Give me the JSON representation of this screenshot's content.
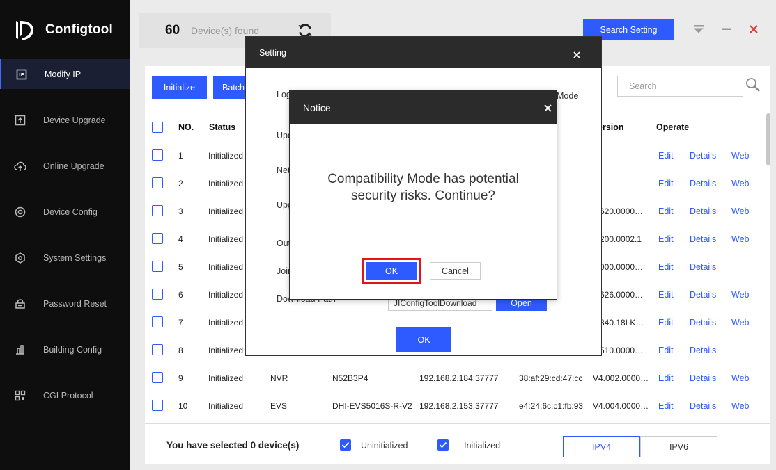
{
  "app": {
    "name": "Configtool"
  },
  "sidebar": {
    "items": [
      {
        "label": "Modify IP",
        "icon": "ip-icon",
        "active": true
      },
      {
        "label": "Device Upgrade",
        "icon": "upgrade-icon"
      },
      {
        "label": "Online Upgrade",
        "icon": "cloud-upgrade-icon"
      },
      {
        "label": "Device Config",
        "icon": "target-icon"
      },
      {
        "label": "System Settings",
        "icon": "hexagon-gear-icon"
      },
      {
        "label": "Password Reset",
        "icon": "lock-icon"
      },
      {
        "label": "Building Config",
        "icon": "building-icon"
      },
      {
        "label": "CGI Protocol",
        "icon": "qr-icon"
      }
    ]
  },
  "topbar": {
    "count": "60",
    "found_label": "Device(s) found",
    "search_setting_label": "Search Setting"
  },
  "toolbar": {
    "initialize_label": "Initialize",
    "batch_label": "Batch",
    "search_placeholder": "Search"
  },
  "table": {
    "headers": {
      "no": "NO.",
      "status": "Status",
      "version": "ersion",
      "operate": "Operate"
    },
    "rows": [
      {
        "no": "1",
        "status": "Initialized",
        "type": "",
        "model": "",
        "ip": "",
        "mac": "",
        "version": "",
        "edit": "Edit",
        "details": "Details",
        "web": "Web"
      },
      {
        "no": "2",
        "status": "Initialized",
        "type": "",
        "model": "",
        "ip": "",
        "mac": "",
        "version": "",
        "edit": "Edit",
        "details": "Details",
        "web": "Web"
      },
      {
        "no": "3",
        "status": "Initialized",
        "type": "",
        "model": "",
        "ip": "",
        "mac": "",
        "version": "2.620.0000…",
        "edit": "Edit",
        "details": "Details",
        "web": "Web"
      },
      {
        "no": "4",
        "status": "Initialized",
        "type": "",
        "model": "",
        "ip": "",
        "mac": "",
        "version": "3.200.0002.1",
        "edit": "Edit",
        "details": "Details",
        "web": "Web"
      },
      {
        "no": "5",
        "status": "Initialized",
        "type": "",
        "model": "",
        "ip": "",
        "mac": "",
        "version": "2.000.0000…",
        "edit": "Edit",
        "details": "Details",
        "web": ""
      },
      {
        "no": "6",
        "status": "Initialized",
        "type": "",
        "model": "",
        "ip": "",
        "mac": "",
        "version": "2.626.0000…",
        "edit": "Edit",
        "details": "Details",
        "web": "Web"
      },
      {
        "no": "7",
        "status": "Initialized",
        "type": "",
        "model": "",
        "ip": "",
        "mac": "",
        "version": "2.840.18LK…",
        "edit": "Edit",
        "details": "Details",
        "web": "Web"
      },
      {
        "no": "8",
        "status": "Initialized",
        "type": "",
        "model": "",
        "ip": "",
        "mac": "",
        "version": "2.510.0000…",
        "edit": "Edit",
        "details": "Details",
        "web": ""
      },
      {
        "no": "9",
        "status": "Initialized",
        "type": "NVR",
        "model": "N52B3P4",
        "ip": "192.168.2.184:37777",
        "mac": "38:af:29:cd:47:cc",
        "version": "V4.002.0000…",
        "edit": "Edit",
        "details": "Details",
        "web": "Web"
      },
      {
        "no": "10",
        "status": "Initialized",
        "type": "EVS",
        "model": "DHI-EVS5016S-R-V2",
        "ip": "192.168.2.153:37777",
        "mac": "e4:24:6c:c1:fb:93",
        "version": "V4.004.0000…",
        "edit": "Edit",
        "details": "Details",
        "web": "Web"
      }
    ]
  },
  "footer": {
    "selected_text": "You have selected 0  device(s)",
    "uninitialized_label": "Uninitialized",
    "initialized_label": "Initialized",
    "ipv4_label": "IPV4",
    "ipv6_label": "IPV6"
  },
  "setting_dialog": {
    "title": "Setting",
    "labels": [
      "Log Mod",
      "Upd",
      "Net",
      "Upg",
      "Out",
      "Join",
      "Download Path"
    ],
    "compat_mode_label": "Mode",
    "path_value": "JIConfigToolDownload",
    "open_label": "Open",
    "ok_label": "OK"
  },
  "notice_dialog": {
    "title": "Notice",
    "message": "Compatibility Mode has potential security risks. Continue?",
    "ok_label": "OK",
    "cancel_label": "Cancel"
  },
  "colors": {
    "accent": "#2e5bff",
    "sidebar_bg": "#0e0e0e",
    "highlight": "#e3151a",
    "close_red": "#e53935"
  }
}
